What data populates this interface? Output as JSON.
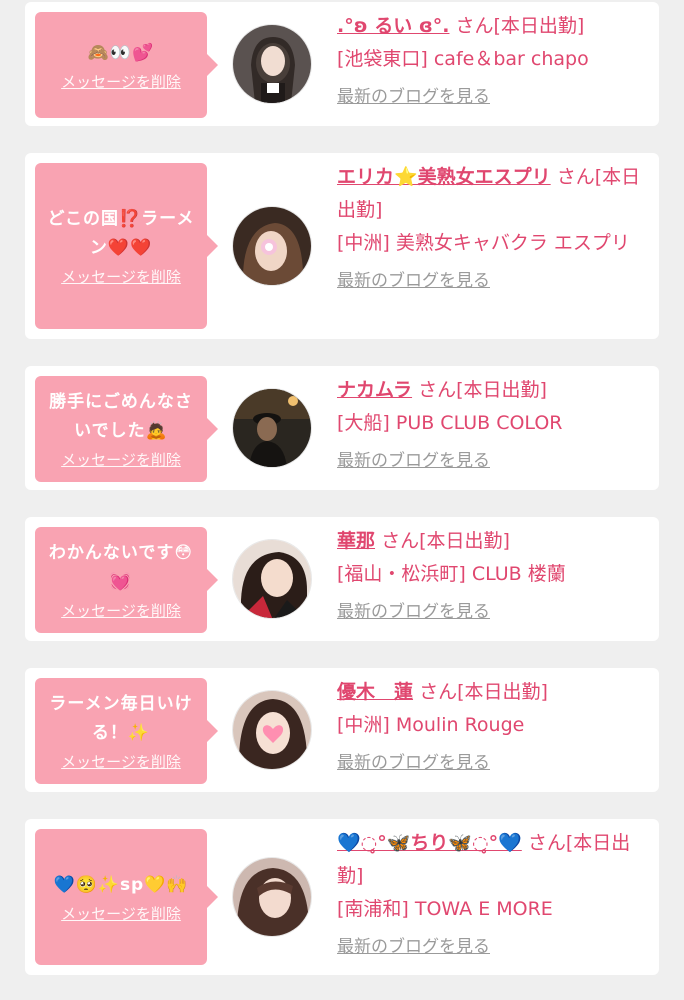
{
  "entries": [
    {
      "message": "🙈👀💕",
      "delete_label": "メッセージを削除",
      "name": ".°ʚ るい ɞ°.",
      "san_suffix": "さん[本日出勤]",
      "shop": "[池袋東口] cafe＆bar chapo",
      "blog_label": "最新のブログを見る"
    },
    {
      "message": "どこの国⁉️ラーメン❤️❤️",
      "delete_label": "メッセージを削除",
      "name": "エリカ⭐️美熟女エスプリ",
      "san_suffix": "さん[本日出勤]",
      "shop": "[中洲] 美熟女キャバクラ エスプリ",
      "blog_label": "最新のブログを見る"
    },
    {
      "message": "勝手にごめんなさいでした🙇",
      "delete_label": "メッセージを削除",
      "name": "ナカムラ",
      "san_suffix": "さん[本日出勤]",
      "shop": "[大船] PUB CLUB COLOR",
      "blog_label": "最新のブログを見る"
    },
    {
      "message": "わかんないです😳💓",
      "delete_label": "メッセージを削除",
      "name": "華那",
      "san_suffix": "さん[本日出勤]",
      "shop": "[福山・松浜町] CLUB 楼蘭",
      "blog_label": "最新のブログを見る"
    },
    {
      "message": "ラーメン毎日いける！✨",
      "delete_label": "メッセージを削除",
      "name": "優木　蓮",
      "san_suffix": "さん[本日出勤]",
      "shop": "[中洲] Moulin Rouge",
      "blog_label": "最新のブログを見る"
    },
    {
      "message": "💙🥺✨sp💛🙌",
      "delete_label": "メッセージを削除",
      "name": "💙◌̥°🦋ちり🦋◌̥°💙",
      "san_suffix": "さん[本日出勤]",
      "shop": "[南浦和] TOWA E MORE",
      "blog_label": "最新のブログを見る"
    }
  ],
  "colors": {
    "page_bg": "#efefef",
    "card_bg": "#ffffff",
    "bubble_bg": "#f9a3b2",
    "accent_text": "#e0476f",
    "muted_link": "#9a9a9a"
  }
}
